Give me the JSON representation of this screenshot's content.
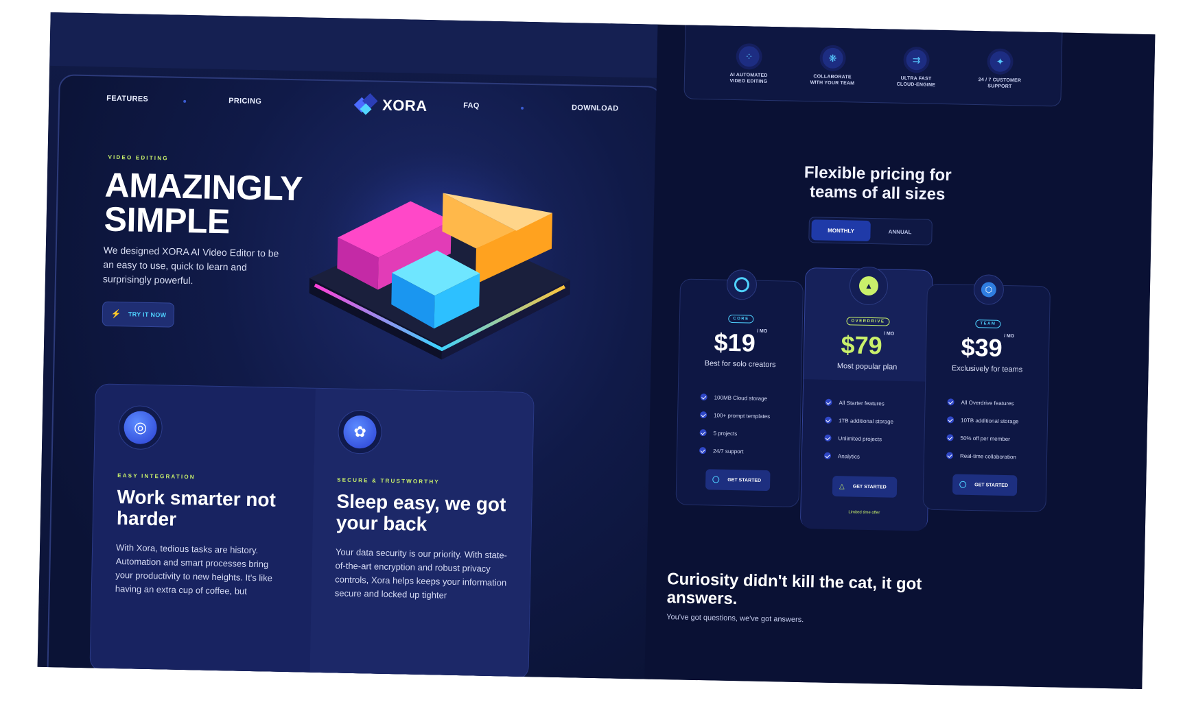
{
  "nav": {
    "left": [
      "FEATURES",
      "PRICING"
    ],
    "right": [
      "FAQ",
      "DOWNLOAD"
    ],
    "logo": "XORA"
  },
  "hero": {
    "kicker": "VIDEO EDITING",
    "title_line1": "AMAZINGLY",
    "title_line2": "SIMPLE",
    "lead": "We designed XORA AI Video Editor to be an easy to use, quick to learn and surprisingly powerful.",
    "cta": "TRY IT NOW"
  },
  "cards": [
    {
      "kicker": "EASY INTEGRATION",
      "title": "Work smarter not harder",
      "body": "With Xora, tedious tasks are history. Automation and smart processes bring your productivity to new heights. It's like having an extra cup of coffee, but"
    },
    {
      "kicker": "SECURE & TRUSTWORTHY",
      "title": "Sleep easy, we got your back",
      "body": "Your data security is our priority. With state-of-the-art encryption and robust privacy controls, Xora helps keeps your information secure and locked up tighter"
    }
  ],
  "features": [
    {
      "label": "AI AUTOMATED\nVIDEO EDITING",
      "icon": "grid-icon"
    },
    {
      "label": "COLLABORATE\nWITH YOUR TEAM",
      "icon": "swirl-icon"
    },
    {
      "label": "ULTRA FAST\nCLOUD-ENGINE",
      "icon": "bolt-icon"
    },
    {
      "label": "24 / 7 CUSTOMER\nSUPPORT",
      "icon": "wand-icon"
    }
  ],
  "pricing": {
    "title": "Flexible pricing for teams of all sizes",
    "toggle": [
      "MONTHLY",
      "ANNUAL"
    ],
    "per": "/ MO",
    "plans": [
      {
        "badge": "CORE",
        "price": "$19",
        "desc": "Best for solo creators",
        "features": [
          "100MB Cloud storage",
          "100+ prompt templates",
          "5 projects",
          "24/7 support"
        ],
        "button": "GET STARTED"
      },
      {
        "badge": "OVERDRIVE",
        "price": "$79",
        "desc": "Most popular plan",
        "features": [
          "All Starter features",
          "1TB additional storage",
          "Unlimited projects",
          "Analytics"
        ],
        "button": "GET STARTED",
        "note": "Limited time offer"
      },
      {
        "badge": "TEAM",
        "price": "$39",
        "desc": "Exclusively for teams",
        "features": [
          "All Overdrive features",
          "10TB additional storage",
          "50% off per member",
          "Real-time collaboration"
        ],
        "button": "GET STARTED"
      }
    ]
  },
  "faq": {
    "title": "Curiosity didn't kill the cat, it got answers.",
    "sub": "You've got questions, we've got answers."
  },
  "colors": {
    "accent_lime": "#c9f06b",
    "accent_cyan": "#4fd1ff",
    "bg": "#0b1236"
  }
}
